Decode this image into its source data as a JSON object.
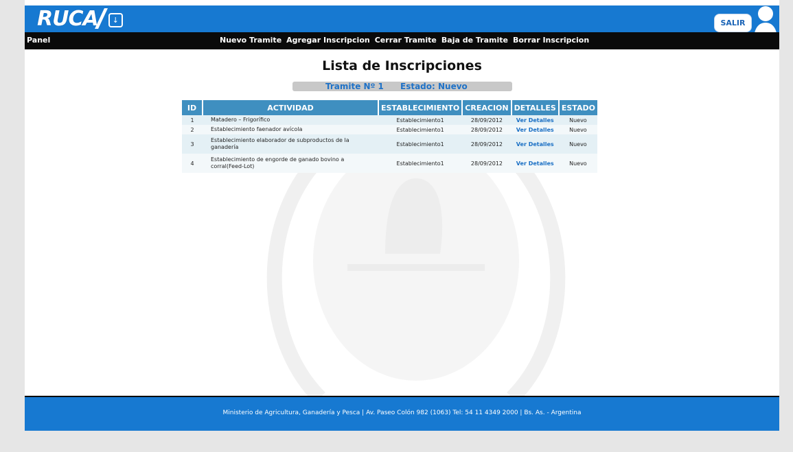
{
  "header": {
    "logo_text": "RUCA",
    "logout_label": "SALIR",
    "brand_color": "#1779d1"
  },
  "nav": {
    "panel_label": "Panel",
    "items": [
      "Nuevo Tramite",
      "Agregar Inscripcion",
      "Cerrar Tramite",
      "Baja de Tramite",
      "Borrar Inscripcion"
    ]
  },
  "main": {
    "title": "Lista de Inscripciones",
    "tramite_label": "Tramite Nº 1",
    "estado_label": "Estado: Nuevo",
    "table": {
      "headers": [
        "ID",
        "ACTIVIDAD",
        "ESTABLECIMIENTO",
        "CREACION",
        "DETALLES",
        "ESTADO"
      ],
      "rows": [
        {
          "id": "1",
          "actividad": "Matadero – Frigorífico",
          "establecimiento": "Establecimiento1",
          "creacion": "28/09/2012",
          "detalles": "Ver Detalles",
          "estado": "Nuevo"
        },
        {
          "id": "2",
          "actividad": "Establecimiento faenador avícola",
          "establecimiento": "Establecimiento1",
          "creacion": "28/09/2012",
          "detalles": "Ver Detalles",
          "estado": "Nuevo"
        },
        {
          "id": "3",
          "actividad": "Establecimiento elaborador de subproductos de la ganadería",
          "establecimiento": "Establecimiento1",
          "creacion": "28/09/2012",
          "detalles": "Ver Detalles",
          "estado": "Nuevo"
        },
        {
          "id": "4",
          "actividad": "Establecimiento de engorde de ganado bovino a corral(Feed-Lot)",
          "establecimiento": "Establecimiento1",
          "creacion": "28/09/2012",
          "detalles": "Ver Detalles",
          "estado": "Nuevo"
        }
      ]
    }
  },
  "footer": {
    "text": "Ministerio de Agricultura, Ganadería y Pesca | Av. Paseo Colón 982 (1063) Tel: 54 11 4349 2000 | Bs. As. - Argentina"
  },
  "icons": {
    "logo_arrow": "download-arrow-icon",
    "user": "user-silhouette-icon",
    "watermark": "national-emblem-watermark"
  }
}
